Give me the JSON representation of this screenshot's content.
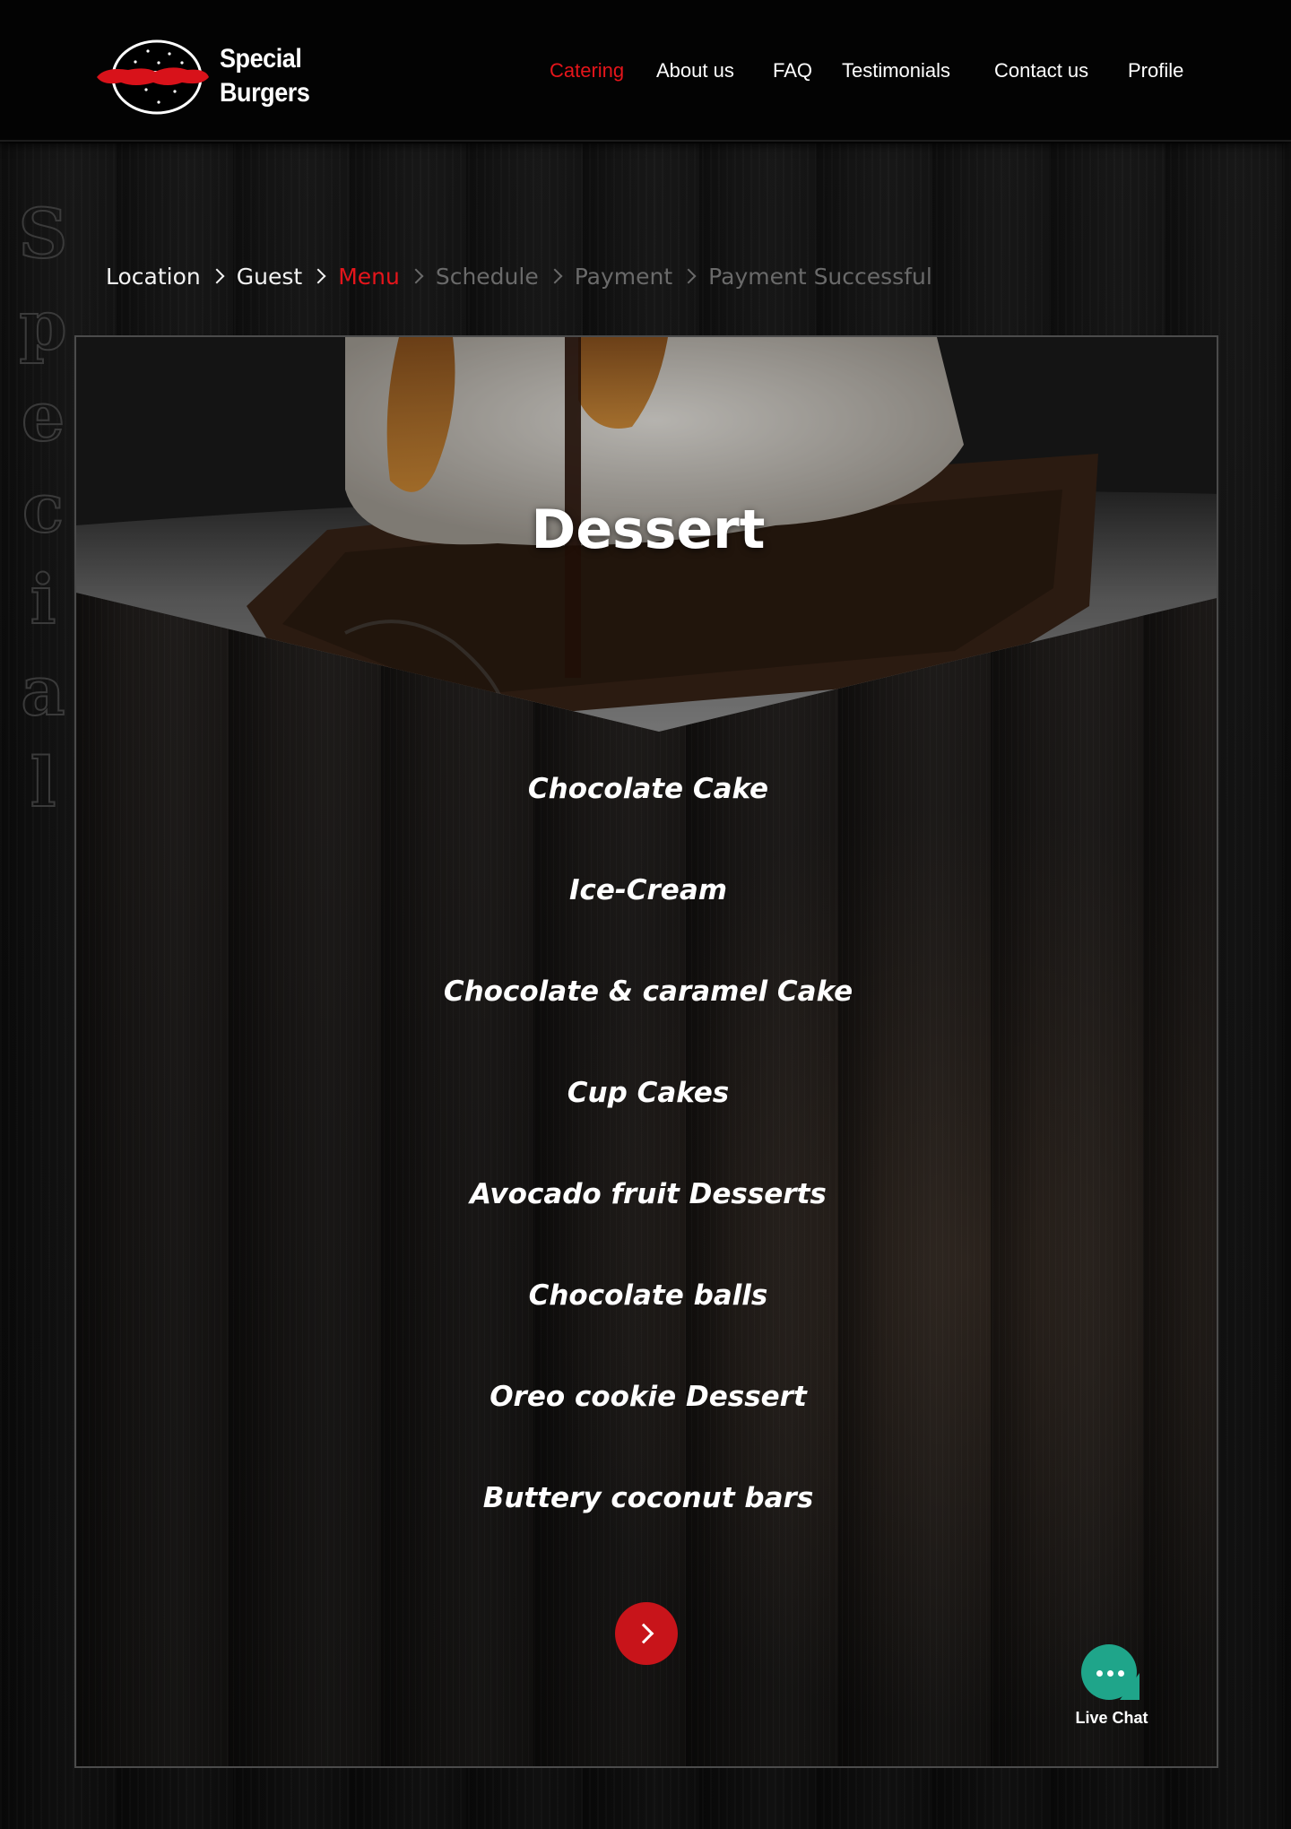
{
  "brand": {
    "line1": "Special",
    "line2": "Burgers",
    "accent_color": "#e5151b"
  },
  "nav": {
    "items": [
      {
        "label": "Catering",
        "active": true
      },
      {
        "label": "About us",
        "active": false
      },
      {
        "label": "FAQ",
        "active": false
      },
      {
        "label": "Testimonials",
        "active": false
      },
      {
        "label": "Contact us",
        "active": false
      },
      {
        "label": "Profile",
        "active": false
      }
    ]
  },
  "side_word": [
    "S",
    "p",
    "e",
    "c",
    "i",
    "a",
    "l"
  ],
  "breadcrumb": {
    "steps": [
      {
        "label": "Location",
        "state": "done"
      },
      {
        "label": "Guest",
        "state": "done"
      },
      {
        "label": "Menu",
        "state": "current"
      },
      {
        "label": "Schedule",
        "state": "todo"
      },
      {
        "label": "Payment",
        "state": "todo"
      },
      {
        "label": "Payment Successful",
        "state": "todo"
      }
    ]
  },
  "category": {
    "title": "Dessert"
  },
  "menu": {
    "items": [
      "Chocolate Cake",
      "Ice-Cream",
      "Chocolate & caramel Cake",
      "Cup Cakes",
      "Avocado fruit Desserts",
      "Chocolate balls",
      "Oreo cookie Dessert",
      "Buttery coconut bars"
    ]
  },
  "next_button": {
    "icon": "chevron-right-icon",
    "color": "#c8141a"
  },
  "live_chat": {
    "label": "Live Chat",
    "icon": "chat-bubble-icon",
    "color": "#1fa58a"
  }
}
